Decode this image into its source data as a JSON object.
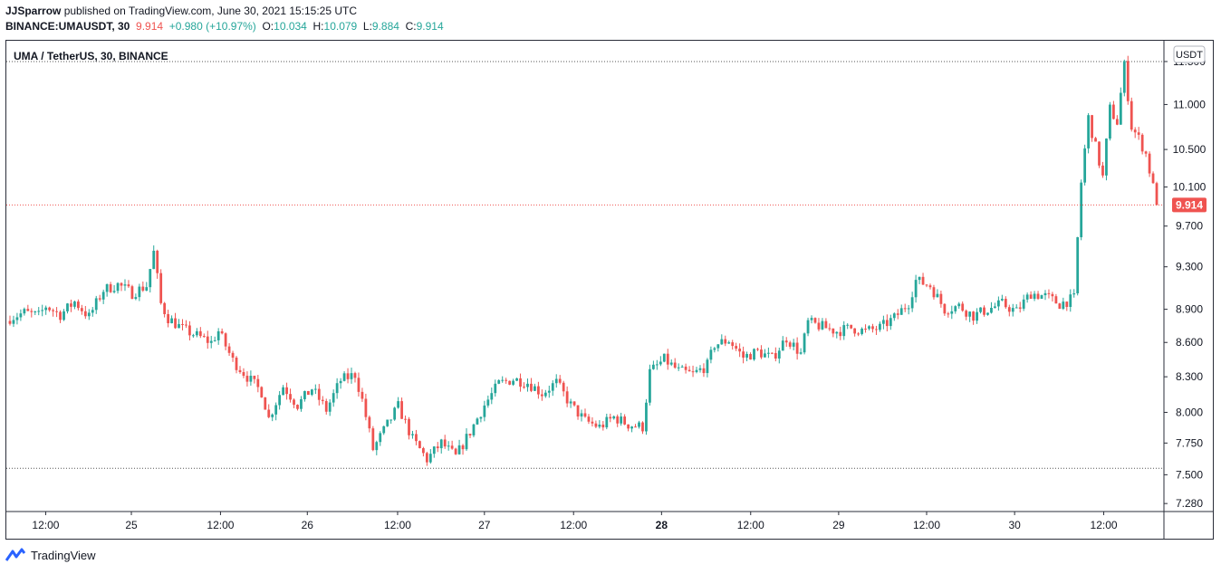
{
  "header": {
    "publisher": "JJSparrow",
    "published_text": "published on TradingView.com, June 30, 2021 15:15:25 UTC",
    "symbol_line": "BINANCE:UMAUSDT, 30",
    "last": "9.914",
    "change": "+0.980 (+10.97%)",
    "o_label": "O:",
    "o_value": "10.034",
    "h_label": "H:",
    "h_value": "10.079",
    "l_label": "L:",
    "l_value": "9.884",
    "c_label": "C:",
    "c_value": "9.914"
  },
  "chart_title": "UMA / TetherUS, 30, BINANCE",
  "currency_label": "USDT",
  "footer": {
    "brand": "TradingView"
  },
  "colors": {
    "up": "#26a69a",
    "down": "#ef5350",
    "last_price": "#ef5350",
    "axis": "#131722"
  },
  "chart_data": {
    "type": "candlestick",
    "title": "UMA / TetherUS, 30, BINANCE",
    "y_axis": "log",
    "ylim": [
      7.22,
      11.75
    ],
    "y_ticks": [
      11.5,
      11.0,
      10.5,
      10.1,
      9.7,
      9.3,
      8.9,
      8.6,
      8.3,
      8.0,
      7.75,
      7.5,
      7.28
    ],
    "y_tick_labels": [
      "11.500",
      "11.000",
      "10.500",
      "10.100",
      "9.700",
      "9.300",
      "8.900",
      "8.600",
      "8.300",
      "8.000",
      "7.750",
      "7.500",
      "7.280"
    ],
    "x_ticks": [
      {
        "label": "12:00",
        "pos": 0.034,
        "bold": false
      },
      {
        "label": "25",
        "pos": 0.108,
        "bold": false
      },
      {
        "label": "12:00",
        "pos": 0.185,
        "bold": false
      },
      {
        "label": "26",
        "pos": 0.26,
        "bold": false
      },
      {
        "label": "12:00",
        "pos": 0.338,
        "bold": false
      },
      {
        "label": "27",
        "pos": 0.413,
        "bold": false
      },
      {
        "label": "12:00",
        "pos": 0.49,
        "bold": false
      },
      {
        "label": "28",
        "pos": 0.566,
        "bold": true
      },
      {
        "label": "12:00",
        "pos": 0.643,
        "bold": false
      },
      {
        "label": "29",
        "pos": 0.719,
        "bold": false
      },
      {
        "label": "12:00",
        "pos": 0.795,
        "bold": false
      },
      {
        "label": "30",
        "pos": 0.871,
        "bold": false
      },
      {
        "label": "12:00",
        "pos": 0.948,
        "bold": false
      }
    ],
    "last_price": 9.914,
    "last_price_label": "9.914",
    "dotted_levels": [
      11.5,
      7.55
    ],
    "path": [
      [
        0,
        8.82
      ],
      [
        4,
        8.87
      ],
      [
        8,
        8.84
      ],
      [
        10,
        8.93
      ],
      [
        14,
        8.85
      ],
      [
        18,
        8.97
      ],
      [
        22,
        8.83
      ],
      [
        26,
        9.08
      ],
      [
        30,
        9.13
      ],
      [
        34,
        9.05
      ],
      [
        38,
        9.12
      ],
      [
        40,
        9.44
      ],
      [
        42,
        8.95
      ],
      [
        44,
        8.82
      ],
      [
        48,
        8.72
      ],
      [
        52,
        8.66
      ],
      [
        56,
        8.6
      ],
      [
        58,
        8.7
      ],
      [
        62,
        8.44
      ],
      [
        66,
        8.3
      ],
      [
        70,
        8.17
      ],
      [
        72,
        7.95
      ],
      [
        76,
        8.22
      ],
      [
        80,
        8.06
      ],
      [
        84,
        8.2
      ],
      [
        88,
        8.02
      ],
      [
        92,
        8.27
      ],
      [
        96,
        8.32
      ],
      [
        98,
        8.1
      ],
      [
        101,
        7.7
      ],
      [
        104,
        7.85
      ],
      [
        108,
        8.05
      ],
      [
        112,
        7.78
      ],
      [
        116,
        7.62
      ],
      [
        120,
        7.75
      ],
      [
        124,
        7.64
      ],
      [
        128,
        7.84
      ],
      [
        132,
        8.06
      ],
      [
        136,
        8.24
      ],
      [
        140,
        8.28
      ],
      [
        144,
        8.25
      ],
      [
        148,
        8.16
      ],
      [
        152,
        8.25
      ],
      [
        156,
        8.06
      ],
      [
        160,
        7.93
      ],
      [
        164,
        7.88
      ],
      [
        168,
        7.96
      ],
      [
        172,
        7.9
      ],
      [
        176,
        7.88
      ],
      [
        178,
        8.34
      ],
      [
        182,
        8.45
      ],
      [
        186,
        8.35
      ],
      [
        190,
        8.32
      ],
      [
        194,
        8.4
      ],
      [
        196,
        8.58
      ],
      [
        200,
        8.62
      ],
      [
        204,
        8.47
      ],
      [
        208,
        8.52
      ],
      [
        212,
        8.46
      ],
      [
        216,
        8.64
      ],
      [
        220,
        8.5
      ],
      [
        222,
        8.78
      ],
      [
        226,
        8.74
      ],
      [
        230,
        8.7
      ],
      [
        234,
        8.73
      ],
      [
        238,
        8.7
      ],
      [
        242,
        8.73
      ],
      [
        246,
        8.82
      ],
      [
        250,
        8.96
      ],
      [
        252,
        9.17
      ],
      [
        256,
        9.12
      ],
      [
        260,
        8.9
      ],
      [
        264,
        8.93
      ],
      [
        268,
        8.84
      ],
      [
        272,
        8.9
      ],
      [
        276,
        8.95
      ],
      [
        280,
        8.88
      ],
      [
        284,
        9.05
      ],
      [
        288,
        9.02
      ],
      [
        292,
        8.95
      ],
      [
        296,
        9.0
      ],
      [
        298,
        10.15
      ],
      [
        300,
        10.85
      ],
      [
        304,
        10.2
      ],
      [
        306,
        10.95
      ],
      [
        308,
        10.8
      ],
      [
        310,
        11.45
      ],
      [
        312,
        10.75
      ],
      [
        314,
        10.62
      ],
      [
        316,
        10.45
      ],
      [
        318,
        10.1
      ],
      [
        319,
        9.914
      ]
    ]
  }
}
